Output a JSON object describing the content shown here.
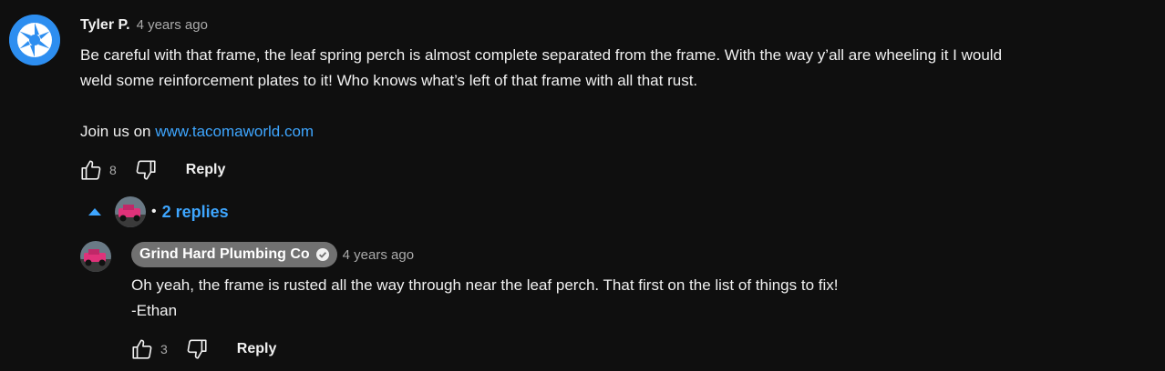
{
  "comment": {
    "author": "Tyler P.",
    "time": "4 years ago",
    "line1": "Be careful with that frame, the leaf spring perch is almost complete separated from the frame. With the way y’all are wheeling it I would",
    "line2": "weld some reinforcement plates to it! Who knows what’s left of that frame with all that rust.",
    "join_prefix": "Join us on",
    "link": "www.tacomaworld.com",
    "likes": "8",
    "reply_label": "Reply",
    "avatar_icon": "camera-aperture-icon",
    "accent_color": "#2d8ef0"
  },
  "replies_toggle": {
    "label": "2 replies",
    "dot": "•",
    "icon": "chevron-up-icon"
  },
  "reply": {
    "author": "Grind Hard Plumbing Co",
    "verified_icon": "verified-check-icon",
    "time": "4 years ago",
    "line1": "Oh yeah, the frame is rusted all the way through near the leaf perch. That first on the list of things to fix!",
    "line2": "-Ethan",
    "likes": "3",
    "reply_label": "Reply"
  },
  "colors": {
    "background": "#0f0f0f",
    "link": "#3ea6ff",
    "chip": "#717171",
    "muted": "#aaaaaa"
  }
}
